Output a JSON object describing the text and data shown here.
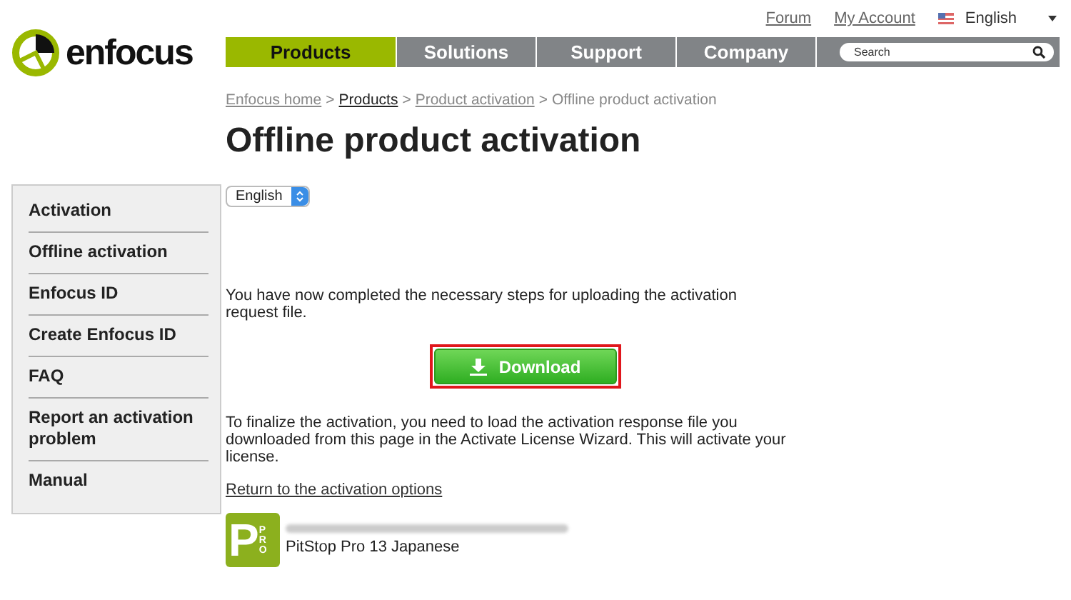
{
  "top_links": [
    {
      "label": "Forum"
    },
    {
      "label": "My Account"
    }
  ],
  "language_menu": {
    "label": "English"
  },
  "logo": {
    "text": "enfocus"
  },
  "nav": [
    {
      "label": "Products",
      "selected": true
    },
    {
      "label": "Solutions",
      "selected": false
    },
    {
      "label": "Support",
      "selected": false
    },
    {
      "label": "Company",
      "selected": false
    }
  ],
  "search": {
    "placeholder": "Search"
  },
  "breadcrumb": [
    {
      "label": "Enfocus home",
      "kind": "link"
    },
    {
      "label": "Products",
      "kind": "current"
    },
    {
      "label": "Product activation",
      "kind": "link"
    },
    {
      "label": "Offline product activation",
      "kind": "text"
    }
  ],
  "breadcrumb_separator": ">",
  "title": "Offline product activation",
  "sidebar": [
    {
      "label": "Activation"
    },
    {
      "label": "Offline activation"
    },
    {
      "label": "Enfocus ID"
    },
    {
      "label": "Create Enfocus ID"
    },
    {
      "label": "FAQ"
    },
    {
      "label": "Report an activation problem"
    },
    {
      "label": "Manual"
    }
  ],
  "language_select": {
    "value": "English"
  },
  "intro": "You have now completed the necessary steps for uploading the activation request file.",
  "download_button": {
    "label": "Download",
    "highlighted": true
  },
  "instructions": "To finalize the activation, you need to load the activation response file you downloaded from this page in the Activate License Wizard. This will activate your license.",
  "return_link": "Return to the activation options",
  "product": {
    "logo_letter": "P",
    "logo_badge": "PRO",
    "name": "PitStop Pro 13 Japanese"
  }
}
